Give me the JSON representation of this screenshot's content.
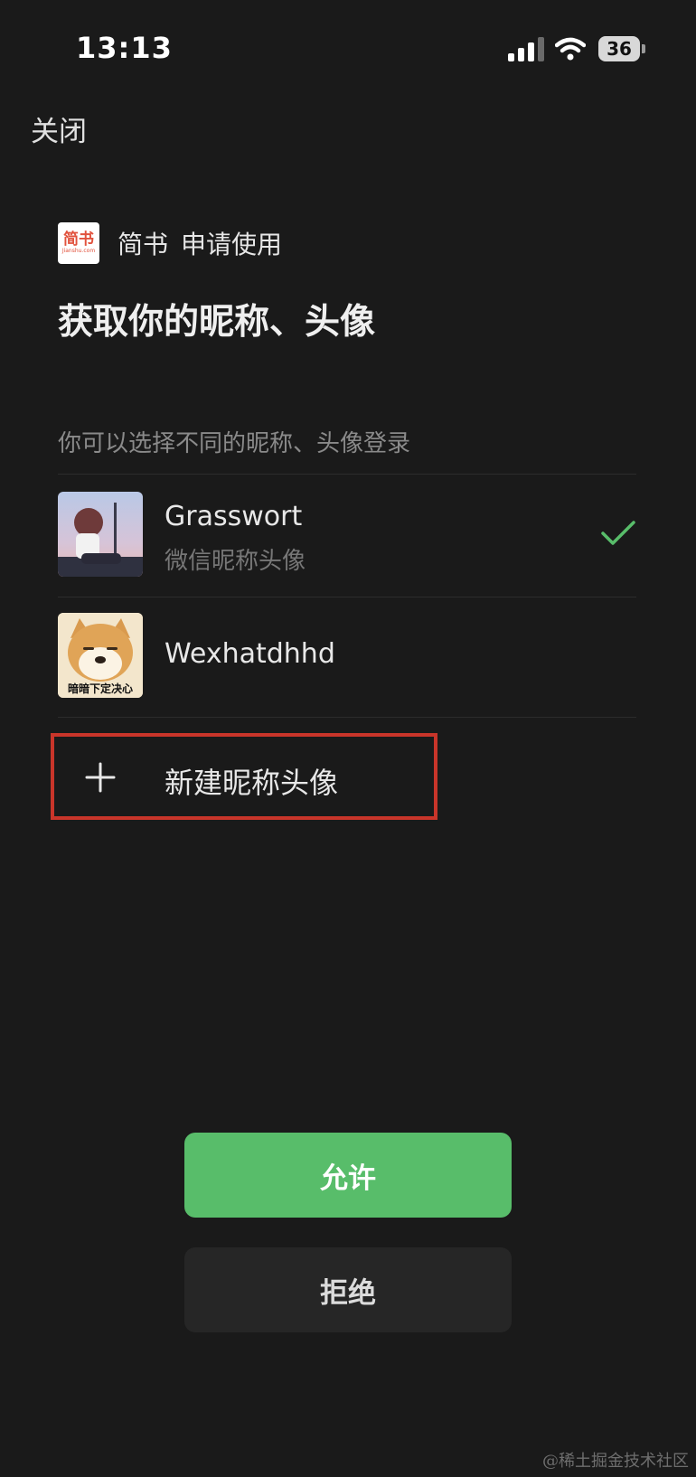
{
  "status_bar": {
    "time": "13:13",
    "battery": "36"
  },
  "header": {
    "close_label": "关闭"
  },
  "app": {
    "logo_text": "简书",
    "logo_subtext": "Jianshu.com",
    "name": "简书",
    "request_text": "申请使用"
  },
  "title": "获取你的昵称、头像",
  "hint": "你可以选择不同的昵称、头像登录",
  "profiles": [
    {
      "name": "Grasswort",
      "subtitle": "微信昵称头像",
      "selected": true
    },
    {
      "name": "Wexhatdhhd",
      "avatar_caption": "暗暗下定决心",
      "selected": false
    }
  ],
  "new_profile_label": "新建昵称头像",
  "buttons": {
    "allow": "允许",
    "deny": "拒绝"
  },
  "watermark": "@稀土掘金技术社区",
  "colors": {
    "background": "#1a1a1a",
    "accent_green": "#58bd6a",
    "highlight_red": "#c9352a"
  }
}
